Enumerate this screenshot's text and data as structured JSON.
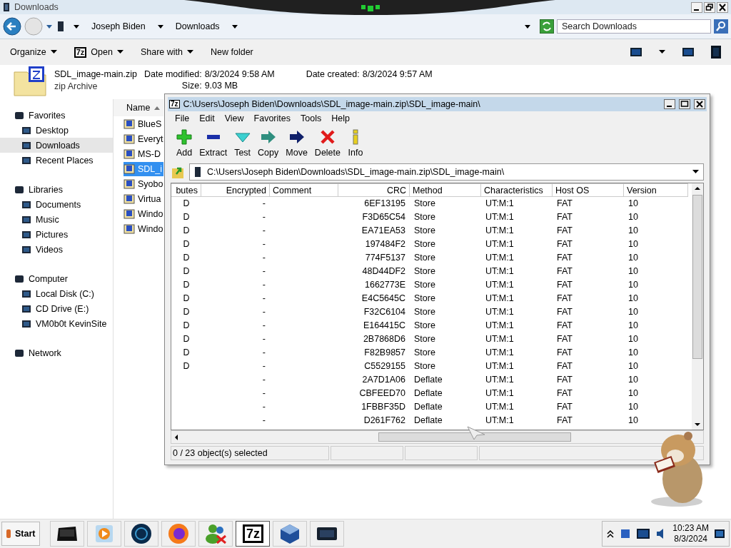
{
  "explorer": {
    "title": "Downloads",
    "breadcrumb": [
      "Joseph Biden",
      "Downloads"
    ],
    "search": {
      "placeholder": "Search Downloads"
    },
    "commands": [
      {
        "label": "Organize",
        "dropdown": true
      },
      {
        "label": "Open",
        "icon_text": "7z",
        "dropdown": true
      },
      {
        "label": "Share with",
        "dropdown": true
      },
      {
        "label": "New folder",
        "dropdown": false
      }
    ],
    "details": {
      "name": "SDL_image-main.zip",
      "type": "zip Archive",
      "fields": [
        {
          "label": "Date modified:",
          "value": "8/3/2024 9:58 AM"
        },
        {
          "label": "Date created:",
          "value": "8/3/2024 9:57 AM"
        },
        {
          "label": "Size:",
          "value": "9.03 MB"
        }
      ]
    },
    "sidebar": [
      {
        "label": "Favorites",
        "children": [
          {
            "label": "Desktop",
            "selected": false
          },
          {
            "label": "Downloads",
            "selected": true
          },
          {
            "label": "Recent Places",
            "selected": false
          }
        ]
      },
      {
        "label": "Libraries",
        "children": [
          {
            "label": "Documents",
            "selected": false
          },
          {
            "label": "Music",
            "selected": false
          },
          {
            "label": "Pictures",
            "selected": false
          },
          {
            "label": "Videos",
            "selected": false
          }
        ]
      },
      {
        "label": "Computer",
        "children": [
          {
            "label": "Local Disk (C:)",
            "selected": false
          },
          {
            "label": "CD Drive (E:)",
            "selected": false
          },
          {
            "label": "VM0b0t KevinSite",
            "selected": false
          }
        ]
      },
      {
        "label": "Network"
      }
    ],
    "file_list": {
      "column": "Name",
      "files": [
        {
          "name": "BlueS",
          "selected": false
        },
        {
          "name": "Everyt",
          "selected": false
        },
        {
          "name": "MS-D",
          "selected": false
        },
        {
          "name": "SDL_i",
          "selected": true
        },
        {
          "name": "Syobo",
          "selected": false
        },
        {
          "name": "Virtua",
          "selected": false
        },
        {
          "name": "Windo",
          "selected": false
        },
        {
          "name": "Windo",
          "selected": false
        }
      ]
    }
  },
  "archiver": {
    "title_icon_text": "7z",
    "title": "C:\\Users\\Joseph Biden\\Downloads\\SDL_image-main.zip\\SDL_image-main\\",
    "menu": [
      "File",
      "Edit",
      "View",
      "Favorites",
      "Tools",
      "Help"
    ],
    "tools": [
      {
        "kind": "add",
        "label": "Add"
      },
      {
        "kind": "extract",
        "label": "Extract"
      },
      {
        "kind": "test",
        "label": "Test"
      },
      {
        "kind": "copy",
        "label": "Copy"
      },
      {
        "kind": "move",
        "label": "Move"
      },
      {
        "kind": "delete",
        "label": "Delete"
      },
      {
        "kind": "info",
        "label": "Info"
      }
    ],
    "path": "C:\\Users\\Joseph Biden\\Downloads\\SDL_image-main.zip\\SDL_image-main\\",
    "columns": [
      "butes",
      "Encrypted",
      "Comment",
      "CRC",
      "Method",
      "Characteristics",
      "Host OS",
      "Version"
    ],
    "rows": [
      {
        "attributes": "D",
        "encrypted": "-",
        "crc": "6EF13195",
        "method": "Store",
        "characteristics": "UT:M:1",
        "host_os": "FAT",
        "version": "10"
      },
      {
        "attributes": "D",
        "encrypted": "-",
        "crc": "F3D65C54",
        "method": "Store",
        "characteristics": "UT:M:1",
        "host_os": "FAT",
        "version": "10"
      },
      {
        "attributes": "D",
        "encrypted": "-",
        "crc": "EA71EA53",
        "method": "Store",
        "characteristics": "UT:M:1",
        "host_os": "FAT",
        "version": "10"
      },
      {
        "attributes": "D",
        "encrypted": "-",
        "crc": "197484F2",
        "method": "Store",
        "characteristics": "UT:M:1",
        "host_os": "FAT",
        "version": "10"
      },
      {
        "attributes": "D",
        "encrypted": "-",
        "crc": "774F5137",
        "method": "Store",
        "characteristics": "UT:M:1",
        "host_os": "FAT",
        "version": "10"
      },
      {
        "attributes": "D",
        "encrypted": "-",
        "crc": "48D44DF2",
        "method": "Store",
        "characteristics": "UT:M:1",
        "host_os": "FAT",
        "version": "10"
      },
      {
        "attributes": "D",
        "encrypted": "-",
        "crc": "1662773E",
        "method": "Store",
        "characteristics": "UT:M:1",
        "host_os": "FAT",
        "version": "10"
      },
      {
        "attributes": "D",
        "encrypted": "-",
        "crc": "E4C5645C",
        "method": "Store",
        "characteristics": "UT:M:1",
        "host_os": "FAT",
        "version": "10"
      },
      {
        "attributes": "D",
        "encrypted": "-",
        "crc": "F32C6104",
        "method": "Store",
        "characteristics": "UT:M:1",
        "host_os": "FAT",
        "version": "10"
      },
      {
        "attributes": "D",
        "encrypted": "-",
        "crc": "E164415C",
        "method": "Store",
        "characteristics": "UT:M:1",
        "host_os": "FAT",
        "version": "10"
      },
      {
        "attributes": "D",
        "encrypted": "-",
        "crc": "2B7868D6",
        "method": "Store",
        "characteristics": "UT:M:1",
        "host_os": "FAT",
        "version": "10"
      },
      {
        "attributes": "D",
        "encrypted": "-",
        "crc": "F82B9857",
        "method": "Store",
        "characteristics": "UT:M:1",
        "host_os": "FAT",
        "version": "10"
      },
      {
        "attributes": "D",
        "encrypted": "-",
        "crc": "C5529155",
        "method": "Store",
        "characteristics": "UT:M:1",
        "host_os": "FAT",
        "version": "10"
      },
      {
        "encrypted": "-",
        "crc": "2A7D1A06",
        "method": "Deflate",
        "characteristics": "UT:M:1",
        "host_os": "FAT",
        "version": "10"
      },
      {
        "encrypted": "-",
        "crc": "CBFEED70",
        "method": "Deflate",
        "characteristics": "UT:M:1",
        "host_os": "FAT",
        "version": "10"
      },
      {
        "encrypted": "-",
        "crc": "1FBBF35D",
        "method": "Deflate",
        "characteristics": "UT:M:1",
        "host_os": "FAT",
        "version": "10"
      },
      {
        "encrypted": "-",
        "crc": "D261F762",
        "method": "Deflate",
        "characteristics": "UT:M:1",
        "host_os": "FAT",
        "version": "10"
      }
    ],
    "status": "0 / 23 object(s) selected"
  },
  "taskbar": {
    "start": "Start",
    "apps": [
      {
        "kind": "terminal",
        "selected": false
      },
      {
        "kind": "media",
        "selected": false
      },
      {
        "kind": "globe",
        "selected": false
      },
      {
        "kind": "browser",
        "selected": false
      },
      {
        "kind": "people",
        "selected": false
      },
      {
        "kind": "archiver",
        "label": "7z",
        "selected": true
      },
      {
        "kind": "cube",
        "selected": false
      },
      {
        "kind": "display",
        "selected": false
      }
    ],
    "clock": {
      "time": "10:23 AM",
      "date": "8/3/2024"
    }
  }
}
